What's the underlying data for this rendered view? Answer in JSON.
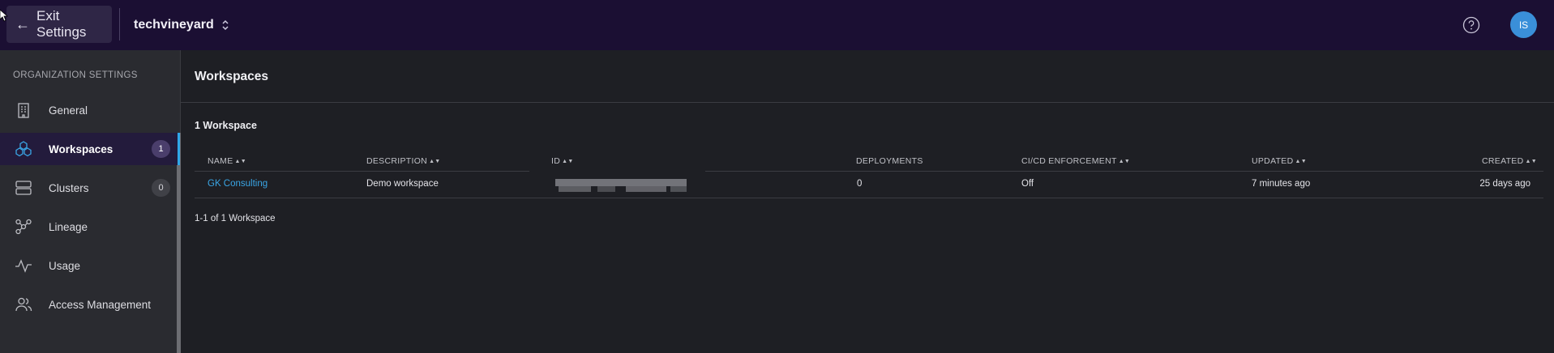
{
  "header": {
    "exit_label": "Exit Settings",
    "org_name": "techvineyard",
    "avatar_initials": "IS"
  },
  "sidebar": {
    "heading": "ORGANIZATION SETTINGS",
    "items": [
      {
        "label": "General",
        "icon": "building-icon"
      },
      {
        "label": "Workspaces",
        "icon": "hexagons-icon",
        "badge": "1",
        "active": true
      },
      {
        "label": "Clusters",
        "icon": "server-icon",
        "badge": "0"
      },
      {
        "label": "Lineage",
        "icon": "graph-nodes-icon"
      },
      {
        "label": "Usage",
        "icon": "pulse-icon"
      },
      {
        "label": "Access Management",
        "icon": "users-icon"
      }
    ]
  },
  "main": {
    "title": "Workspaces",
    "count_label": "1 Workspace",
    "columns": [
      "NAME",
      "DESCRIPTION",
      "ID",
      "DEPLOYMENTS",
      "CI/CD ENFORCEMENT",
      "UPDATED",
      "CREATED"
    ],
    "rows": [
      {
        "name": "GK Consulting",
        "description": "Demo workspace",
        "deployments": "0",
        "cicd": "Off",
        "updated": "7 minutes ago",
        "created": "25 days ago"
      }
    ],
    "pagination": "1-1 of 1 Workspace"
  },
  "colors": {
    "topbar": "#1b0f33",
    "accent": "#2fa6e8",
    "link": "#3aa6e6"
  }
}
